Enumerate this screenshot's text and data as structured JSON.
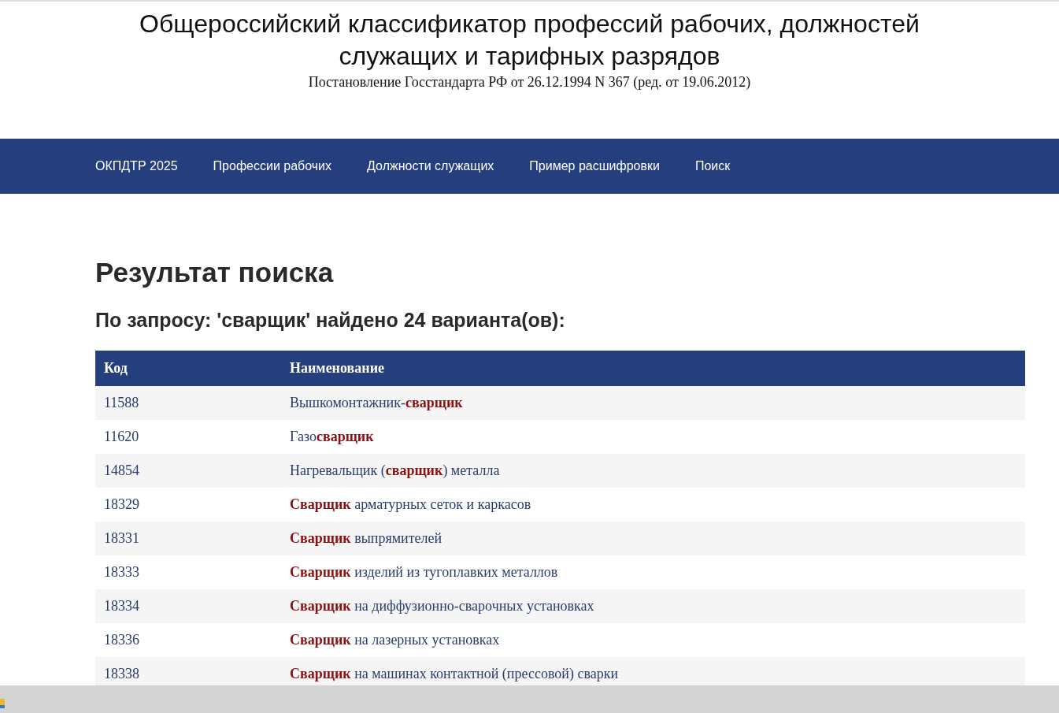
{
  "header": {
    "title": "Общероссийский классификатор профессий рабочих, должностей служащих и тарифных разрядов",
    "subtitle": "Постановление Госстандарта РФ от 26.12.1994 N 367 (ред. от 19.06.2012)"
  },
  "nav": [
    "ОКПДТР 2025",
    "Профессии рабочих",
    "Должности служащих",
    "Пример расшифровки",
    "Поиск"
  ],
  "heading": "Результат поиска",
  "query_summary": "По запросу: 'сварщик' найдено 24 варианта(ов):",
  "table": {
    "columns": [
      "Код",
      "Наименование"
    ],
    "rows": [
      {
        "code": "11588",
        "name": "Вышкомонтажник-**сварщик**"
      },
      {
        "code": "11620",
        "name": "Газо**сварщик**"
      },
      {
        "code": "14854",
        "name": "Нагревальщик (**сварщик**) металла"
      },
      {
        "code": "18329",
        "name": "**Сварщик** арматурных сеток и каркасов"
      },
      {
        "code": "18331",
        "name": "**Сварщик** выпрямителей"
      },
      {
        "code": "18333",
        "name": "**Сварщик** изделий из тугоплавких металлов"
      },
      {
        "code": "18334",
        "name": "**Сварщик** на диффузионно-сварочных установках"
      },
      {
        "code": "18336",
        "name": "**Сварщик** на лазерных установках"
      },
      {
        "code": "18338",
        "name": "**Сварщик** на машинах контактной (прессовой) сварки"
      }
    ]
  }
}
